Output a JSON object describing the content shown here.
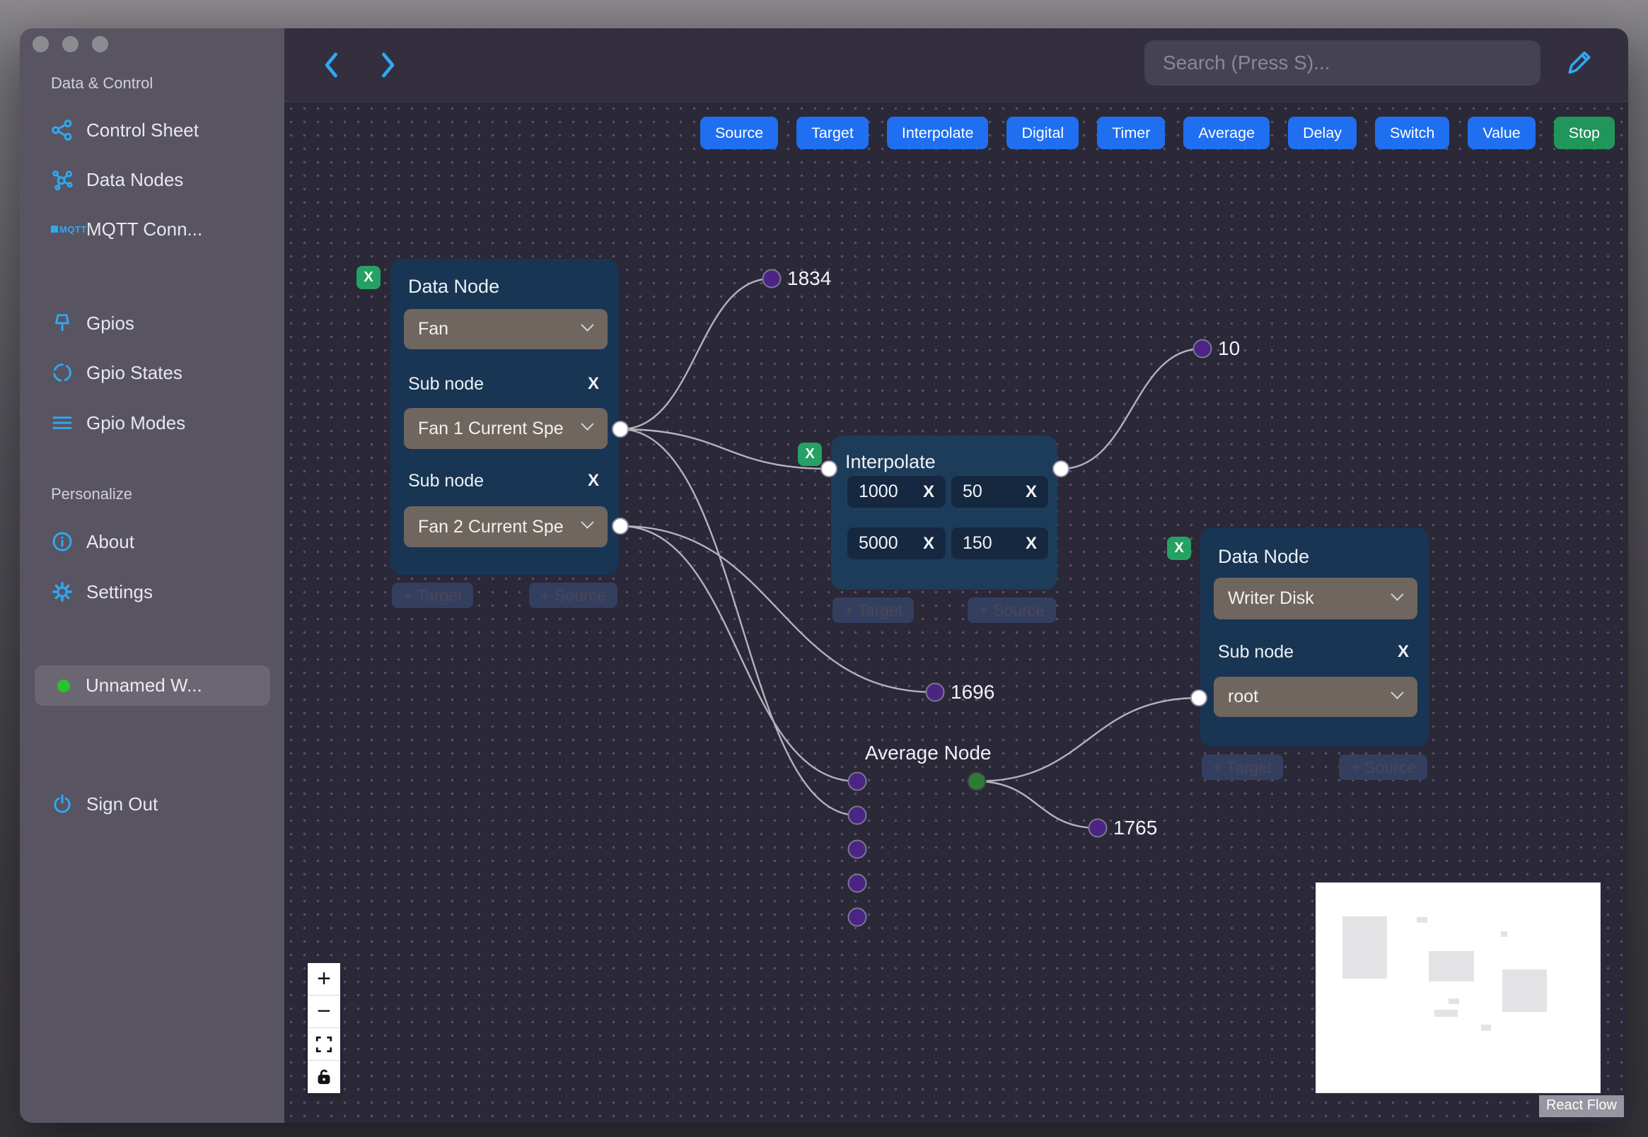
{
  "sidebar": {
    "section1": {
      "header": "Data & Control",
      "items": [
        {
          "label": "Control Sheet"
        },
        {
          "label": "Data Nodes"
        },
        {
          "label": "MQTT Conn..."
        }
      ]
    },
    "section2": {
      "items": [
        {
          "label": "Gpios"
        },
        {
          "label": "Gpio States"
        },
        {
          "label": "Gpio Modes"
        }
      ]
    },
    "section3": {
      "header": "Personalize",
      "items": [
        {
          "label": "About"
        },
        {
          "label": "Settings"
        }
      ]
    },
    "mqtt_logo": "MQTT",
    "workspace": {
      "label": "Unnamed W..."
    },
    "signout": {
      "label": "Sign Out"
    }
  },
  "topbar": {
    "search_placeholder": "Search (Press S)..."
  },
  "toolbar": {
    "buttons": [
      "Source",
      "Target",
      "Interpolate",
      "Digital",
      "Timer",
      "Average",
      "Delay",
      "Switch",
      "Value",
      "Stop"
    ]
  },
  "nodes": {
    "remove_label": "X",
    "clear_label": "X",
    "target_label": "+ Target",
    "source_label": "+ Source",
    "fan": {
      "title": "Data Node",
      "type_value": "Fan",
      "sub_label": "Sub node",
      "sub1_value": "Fan 1 Current Spe",
      "sub2_value": "Fan 2 Current Spe"
    },
    "interpolate": {
      "title": "Interpolate",
      "v1": "1000",
      "v2": "50",
      "v3": "5000",
      "v4": "150"
    },
    "writer": {
      "title": "Data Node",
      "type_value": "Writer Disk",
      "sub_label": "Sub node",
      "sub_value": "root"
    },
    "average": {
      "title": "Average Node"
    }
  },
  "edges": {
    "labels": {
      "a": "1834",
      "b": "10",
      "c": "1696",
      "d": "1765"
    }
  },
  "controls": {
    "zoom_in": "+",
    "zoom_out": "−"
  },
  "minimap": {
    "attribution": "React Flow"
  },
  "colors": {
    "accent_blue": "#2fa9f2",
    "button_blue": "#1f6ff0",
    "button_green": "#21965a",
    "badge_green": "#25a164",
    "node_bg": "#183553",
    "purple_handle": "#4b2484",
    "green_handle": "#2e7c34"
  }
}
